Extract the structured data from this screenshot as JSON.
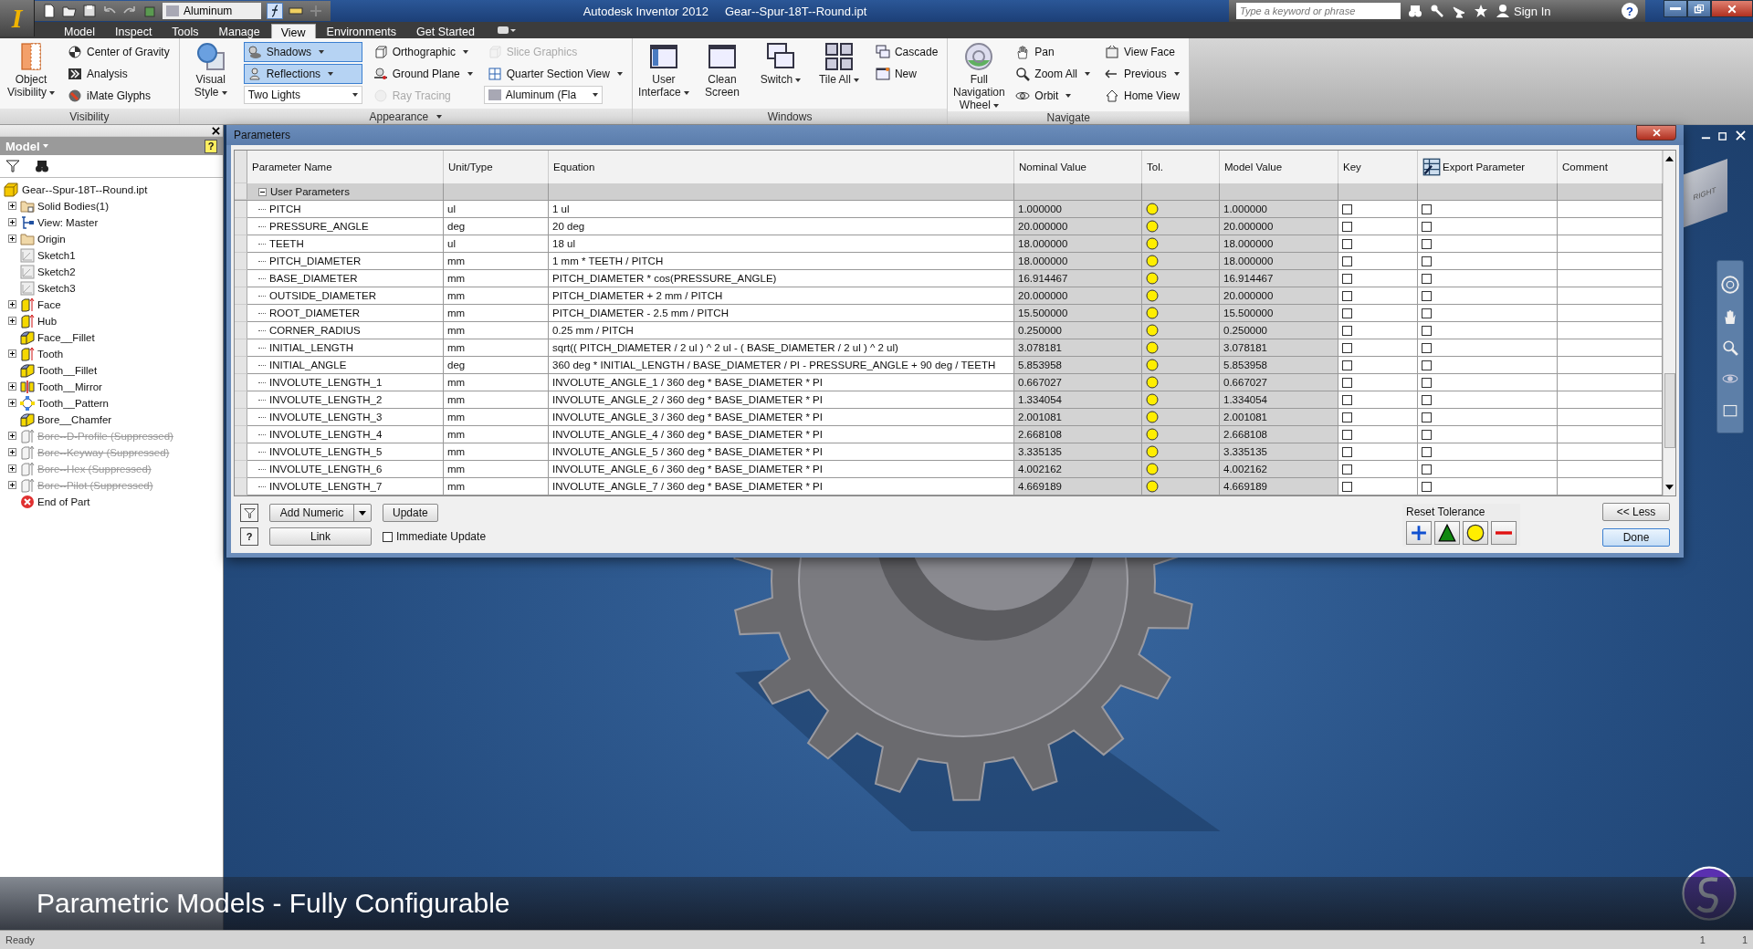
{
  "app_menu": {
    "glyph": "I"
  },
  "quick_access": {
    "material": "Aluminum"
  },
  "window": {
    "app": "Autodesk Inventor 2012",
    "file": "Gear--Spur-18T--Round.ipt"
  },
  "info_center": {
    "placeholder": "Type a keyword or phrase",
    "sign_in": "Sign In",
    "help_glyph": "?"
  },
  "ribbon_tabs": [
    {
      "label": "Model",
      "selected": false
    },
    {
      "label": "Inspect",
      "selected": false
    },
    {
      "label": "Tools",
      "selected": false
    },
    {
      "label": "Manage",
      "selected": false
    },
    {
      "label": "View",
      "selected": true
    },
    {
      "label": "Environments",
      "selected": false
    },
    {
      "label": "Get Started",
      "selected": false
    }
  ],
  "ribbon_panels": [
    {
      "title": "Visibility",
      "menu": false,
      "columns": [
        [
          {
            "label": "Object Visibility",
            "kind": "large",
            "menu": true,
            "selected": false,
            "disabled": false
          }
        ],
        [
          {
            "label": "Center of Gravity",
            "kind": "small",
            "menu": false,
            "selected": false,
            "disabled": false
          },
          {
            "label": "Analysis",
            "kind": "small",
            "menu": false,
            "selected": false,
            "disabled": false
          },
          {
            "label": "iMate Glyphs",
            "kind": "small",
            "menu": false,
            "selected": false,
            "disabled": false
          }
        ]
      ]
    },
    {
      "title": "Appearance",
      "menu": true,
      "columns": [
        [
          {
            "label": "Visual Style",
            "kind": "large",
            "menu": true,
            "selected": false,
            "disabled": false
          }
        ],
        [
          {
            "label": "Shadows",
            "kind": "small",
            "menu": true,
            "selected": true,
            "disabled": false
          },
          {
            "label": "Reflections",
            "kind": "small",
            "menu": true,
            "selected": true,
            "disabled": false
          },
          {
            "label": "Two Lights",
            "kind": "combo",
            "menu": true,
            "selected": false,
            "disabled": false
          }
        ],
        [
          {
            "label": "Orthographic",
            "kind": "small",
            "menu": true,
            "selected": false,
            "disabled": false
          },
          {
            "label": "Ground Plane",
            "kind": "small",
            "menu": true,
            "selected": false,
            "disabled": false
          },
          {
            "label": "Ray Tracing",
            "kind": "small",
            "menu": false,
            "selected": false,
            "disabled": true
          }
        ],
        [
          {
            "label": "Slice Graphics",
            "kind": "small",
            "menu": false,
            "selected": false,
            "disabled": true
          },
          {
            "label": "Quarter Section View",
            "kind": "small",
            "menu": true,
            "selected": false,
            "disabled": false
          },
          {
            "label": "Aluminum (Fla",
            "kind": "material",
            "menu": true,
            "selected": false,
            "disabled": false
          }
        ]
      ]
    },
    {
      "title": "Windows",
      "menu": false,
      "columns": [
        [
          {
            "label": "User Interface",
            "kind": "large",
            "menu": true,
            "selected": false,
            "disabled": false
          }
        ],
        [
          {
            "label": "Clean Screen",
            "kind": "large",
            "menu": false,
            "selected": false,
            "disabled": false
          }
        ],
        [
          {
            "label": "Switch",
            "kind": "large",
            "menu": true,
            "selected": false,
            "disabled": false
          }
        ],
        [
          {
            "label": "Tile All",
            "kind": "large",
            "menu": true,
            "selected": false,
            "disabled": false
          }
        ],
        [
          {
            "label": "Cascade",
            "kind": "small",
            "menu": false,
            "selected": false,
            "disabled": false
          },
          {
            "label": "New",
            "kind": "small",
            "menu": false,
            "selected": false,
            "disabled": false
          }
        ]
      ]
    },
    {
      "title": "Navigate",
      "menu": false,
      "columns": [
        [
          {
            "label": "Full Navigation Wheel",
            "kind": "large",
            "menu": true,
            "selected": false,
            "disabled": false
          }
        ],
        [
          {
            "label": "Pan",
            "kind": "small",
            "menu": false,
            "selected": false,
            "disabled": false
          },
          {
            "label": "Zoom All",
            "kind": "small",
            "menu": true,
            "selected": false,
            "disabled": false
          },
          {
            "label": "Orbit",
            "kind": "small",
            "menu": true,
            "selected": false,
            "disabled": false
          }
        ],
        [
          {
            "label": "View Face",
            "kind": "small",
            "menu": false,
            "selected": false,
            "disabled": false
          },
          {
            "label": "Previous",
            "kind": "small",
            "menu": true,
            "selected": false,
            "disabled": false
          },
          {
            "label": "Home View",
            "kind": "small",
            "menu": false,
            "selected": false,
            "disabled": false
          }
        ]
      ]
    }
  ],
  "browser": {
    "title": "Model",
    "help_glyph": "?",
    "tree": {
      "label": "Gear--Spur-18T--Round.ipt",
      "kind": "part",
      "children": [
        {
          "label": "Solid Bodies(1)",
          "kind": "bodies",
          "expandable": true,
          "suppressed": false
        },
        {
          "label": "View: Master",
          "kind": "view",
          "expandable": true,
          "suppressed": false
        },
        {
          "label": "Origin",
          "kind": "folder",
          "expandable": true,
          "suppressed": false
        },
        {
          "label": "Sketch1",
          "kind": "sketch",
          "expandable": false,
          "suppressed": false
        },
        {
          "label": "Sketch2",
          "kind": "sketch",
          "expandable": false,
          "suppressed": false
        },
        {
          "label": "Sketch3",
          "kind": "sketch",
          "expandable": false,
          "suppressed": false
        },
        {
          "label": "Face",
          "kind": "extrude",
          "expandable": true,
          "suppressed": false
        },
        {
          "label": "Hub",
          "kind": "extrude",
          "expandable": true,
          "suppressed": false
        },
        {
          "label": "Face__Fillet",
          "kind": "fillet",
          "expandable": false,
          "suppressed": false
        },
        {
          "label": "Tooth",
          "kind": "extrude",
          "expandable": true,
          "suppressed": false
        },
        {
          "label": "Tooth__Fillet",
          "kind": "fillet",
          "expandable": false,
          "suppressed": false
        },
        {
          "label": "Tooth__Mirror",
          "kind": "mirror",
          "expandable": true,
          "suppressed": false
        },
        {
          "label": "Tooth__Pattern",
          "kind": "pattern",
          "expandable": true,
          "suppressed": false
        },
        {
          "label": "Bore__Chamfer",
          "kind": "chamfer",
          "expandable": false,
          "suppressed": false
        },
        {
          "label": "Bore--D-Profile (Suppressed)",
          "kind": "extrude",
          "expandable": true,
          "suppressed": true
        },
        {
          "label": "Bore--Keyway (Suppressed)",
          "kind": "extrude",
          "expandable": true,
          "suppressed": true
        },
        {
          "label": "Bore--Hex (Suppressed)",
          "kind": "extrude",
          "expandable": true,
          "suppressed": true
        },
        {
          "label": "Bore--Pilot (Suppressed)",
          "kind": "extrude",
          "expandable": true,
          "suppressed": true
        },
        {
          "label": "End of Part",
          "kind": "end",
          "expandable": false,
          "suppressed": false
        }
      ]
    }
  },
  "parameters_dialog": {
    "title": "Parameters",
    "columns": [
      "Parameter Name",
      "Unit/Type",
      "Equation",
      "Nominal Value",
      "Tol.",
      "Model Value",
      "Key",
      "Export Parameter",
      "Comment"
    ],
    "group": {
      "label": "User Parameters",
      "expanded": true
    },
    "rows": [
      {
        "name": "PITCH",
        "unit": "ul",
        "equation": "1 ul",
        "nominal": "1.000000",
        "model": "1.000000",
        "key": false,
        "export": false
      },
      {
        "name": "PRESSURE_ANGLE",
        "unit": "deg",
        "equation": "20 deg",
        "nominal": "20.000000",
        "model": "20.000000",
        "key": false,
        "export": false
      },
      {
        "name": "TEETH",
        "unit": "ul",
        "equation": "18 ul",
        "nominal": "18.000000",
        "model": "18.000000",
        "key": false,
        "export": false
      },
      {
        "name": "PITCH_DIAMETER",
        "unit": "mm",
        "equation": "1 mm * TEETH / PITCH",
        "nominal": "18.000000",
        "model": "18.000000",
        "key": false,
        "export": false
      },
      {
        "name": "BASE_DIAMETER",
        "unit": "mm",
        "equation": "PITCH_DIAMETER * cos(PRESSURE_ANGLE)",
        "nominal": "16.914467",
        "model": "16.914467",
        "key": false,
        "export": false
      },
      {
        "name": "OUTSIDE_DIAMETER",
        "unit": "mm",
        "equation": "PITCH_DIAMETER + 2 mm / PITCH",
        "nominal": "20.000000",
        "model": "20.000000",
        "key": false,
        "export": false
      },
      {
        "name": "ROOT_DIAMETER",
        "unit": "mm",
        "equation": "PITCH_DIAMETER - 2.5 mm / PITCH",
        "nominal": "15.500000",
        "model": "15.500000",
        "key": false,
        "export": false
      },
      {
        "name": "CORNER_RADIUS",
        "unit": "mm",
        "equation": "0.25 mm / PITCH",
        "nominal": "0.250000",
        "model": "0.250000",
        "key": false,
        "export": false
      },
      {
        "name": "INITIAL_LENGTH",
        "unit": "mm",
        "equation": "sqrt(( PITCH_DIAMETER / 2 ul ) ^ 2 ul - ( BASE_DIAMETER / 2 ul ) ^ 2 ul)",
        "nominal": "3.078181",
        "model": "3.078181",
        "key": false,
        "export": false
      },
      {
        "name": "INITIAL_ANGLE",
        "unit": "deg",
        "equation": "360 deg * INITIAL_LENGTH / BASE_DIAMETER / PI - PRESSURE_ANGLE + 90 deg / TEETH",
        "nominal": "5.853958",
        "model": "5.853958",
        "key": false,
        "export": false
      },
      {
        "name": "INVOLUTE_LENGTH_1",
        "unit": "mm",
        "equation": "INVOLUTE_ANGLE_1 / 360 deg * BASE_DIAMETER * PI",
        "nominal": "0.667027",
        "model": "0.667027",
        "key": false,
        "export": false
      },
      {
        "name": "INVOLUTE_LENGTH_2",
        "unit": "mm",
        "equation": "INVOLUTE_ANGLE_2 / 360 deg * BASE_DIAMETER * PI",
        "nominal": "1.334054",
        "model": "1.334054",
        "key": false,
        "export": false
      },
      {
        "name": "INVOLUTE_LENGTH_3",
        "unit": "mm",
        "equation": "INVOLUTE_ANGLE_3 / 360 deg * BASE_DIAMETER * PI",
        "nominal": "2.001081",
        "model": "2.001081",
        "key": false,
        "export": false
      },
      {
        "name": "INVOLUTE_LENGTH_4",
        "unit": "mm",
        "equation": "INVOLUTE_ANGLE_4 / 360 deg * BASE_DIAMETER * PI",
        "nominal": "2.668108",
        "model": "2.668108",
        "key": false,
        "export": false
      },
      {
        "name": "INVOLUTE_LENGTH_5",
        "unit": "mm",
        "equation": "INVOLUTE_ANGLE_5 / 360 deg * BASE_DIAMETER * PI",
        "nominal": "3.335135",
        "model": "3.335135",
        "key": false,
        "export": false
      },
      {
        "name": "INVOLUTE_LENGTH_6",
        "unit": "mm",
        "equation": "INVOLUTE_ANGLE_6 / 360 deg * BASE_DIAMETER * PI",
        "nominal": "4.002162",
        "model": "4.002162",
        "key": false,
        "export": false
      },
      {
        "name": "INVOLUTE_LENGTH_7",
        "unit": "mm",
        "equation": "INVOLUTE_ANGLE_7 / 360 deg * BASE_DIAMETER * PI",
        "nominal": "4.669189",
        "model": "4.669189",
        "key": false,
        "export": false
      }
    ],
    "add_button": "Add Numeric",
    "update_button": "Update",
    "link_button": "Link",
    "help_glyph": "?",
    "immediate_update": {
      "label": "Immediate Update",
      "checked": false
    },
    "reset_tolerance": "Reset Tolerance",
    "less_button": "<< Less",
    "done_button": "Done"
  },
  "viewcube": {
    "face": "RIGHT"
  },
  "caption": "Parametric Models - Fully Configurable",
  "status_bar": {
    "text": "Ready",
    "count_1": "1",
    "count_2": "1"
  }
}
